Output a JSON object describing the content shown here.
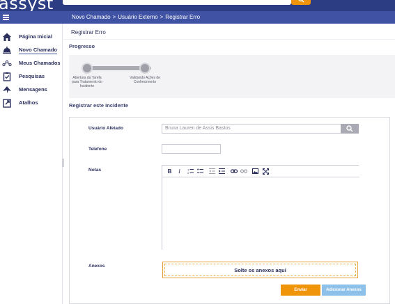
{
  "app": {
    "logo": "assyst"
  },
  "breadcrumb": [
    "Novo Chamado",
    "Usuário Externo",
    "Registrar Erro"
  ],
  "sidebar": {
    "items": [
      {
        "label": "Página Inicial",
        "icon": "home-icon",
        "active": false
      },
      {
        "label": "Novo Chamado",
        "icon": "bell-icon",
        "active": true
      },
      {
        "label": "Meus Chamados",
        "icon": "network-icon",
        "active": false
      },
      {
        "label": "Pesquisas",
        "icon": "clipboard-check-icon",
        "active": false
      },
      {
        "label": "Mensagens",
        "icon": "paper-plane-icon",
        "active": false
      },
      {
        "label": "Atalhos",
        "icon": "external-link-icon",
        "active": false
      }
    ]
  },
  "main": {
    "page_title": "Registrar Erro",
    "progress_heading": "Progresso",
    "steps": [
      {
        "label": "Abertura da Tarefa para Tratamento do Incidente"
      },
      {
        "label": "Validando Ações de Conhecimento"
      }
    ],
    "register_heading": "Registrar este Incidente"
  },
  "form": {
    "user_label": "Usuário Afetado",
    "user_value": "Bruna Lauren de Assis Bastos",
    "phone_label": "Telefone",
    "phone_value": "",
    "notes_label": "Notas",
    "attachments_label": "Anexos",
    "drop_text": "Solte os anexos aqui",
    "send_button": "Enviar",
    "add_attachments_button": "Adicionar Anexos"
  },
  "editor_toolbar": {
    "bold": "B",
    "italic": "I",
    "icons": [
      "bold-icon",
      "italic-icon",
      "numbered-list-icon",
      "bullet-list-icon",
      "outdent-icon",
      "indent-icon",
      "link-icon",
      "unlink-icon",
      "image-icon",
      "fullscreen-icon"
    ]
  },
  "colors": {
    "header": "#2c3d84",
    "subbar": "#3f52a4",
    "accent": "#f0940a",
    "secondary_button": "#8ec1ea"
  }
}
